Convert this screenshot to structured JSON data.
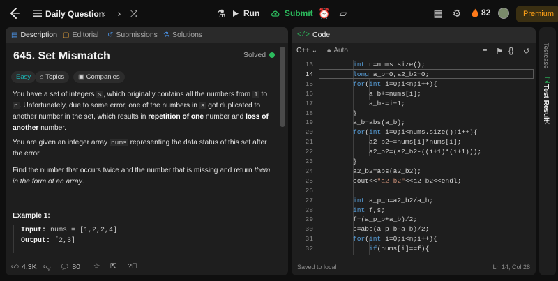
{
  "header": {
    "title": "Daily Question",
    "run_label": "Run",
    "submit_label": "Submit",
    "streak_count": "82",
    "premium_label": "Premium"
  },
  "left_tabs": [
    {
      "label": "Description",
      "icon": "description-icon"
    },
    {
      "label": "Editorial",
      "icon": "editorial-icon"
    },
    {
      "label": "Submissions",
      "icon": "submissions-icon"
    },
    {
      "label": "Solutions",
      "icon": "solutions-icon"
    }
  ],
  "problem": {
    "title": "645. Set Mismatch",
    "status": "Solved",
    "tags": {
      "difficulty": "Easy",
      "topics": "Topics",
      "companies": "Companies"
    },
    "para1": {
      "a": "You have a set of integers ",
      "c1": "s",
      "b": ", which originally contains all the numbers from ",
      "c2": "1",
      "c": " to ",
      "c3": "n",
      "d": ". Unfortunately, due to some error, one of the numbers in ",
      "c4": "s",
      "e": " got duplicated to another number in the set, which results in ",
      "bold1": "repetition of one",
      "f": " number and ",
      "bold2": "loss of another",
      "g": " number."
    },
    "para2": {
      "a": "You are given an integer array ",
      "c1": "nums",
      "b": " representing the data status of this set after the error."
    },
    "para3": {
      "a": "Find the number that occurs twice and the number that is missing and return ",
      "italic": "them in the form of an array",
      "b": "."
    },
    "example_title": "Example 1:",
    "example_input_label": "Input:",
    "example_input_value": "nums = [1,2,2,4]",
    "example_output_label": "Output:",
    "example_output_value": "[2,3]"
  },
  "left_footer": {
    "likes": "4.3K",
    "comments": "80"
  },
  "code_panel": {
    "title": "Code",
    "language": "C++",
    "mode": "Auto",
    "footer_left": "Saved to local",
    "footer_right": "Ln 14, Col 28"
  },
  "code_lines": [
    {
      "n": "13",
      "text": "int n=nums.size();"
    },
    {
      "n": "14",
      "text": "long a_b=0,a2_b2=0;"
    },
    {
      "n": "15",
      "text": "for(int i=0;i<n;i++){"
    },
    {
      "n": "16",
      "text": "a_b+=nums[i];"
    },
    {
      "n": "17",
      "text": "a_b-=i+1;"
    },
    {
      "n": "18",
      "text": "}"
    },
    {
      "n": "19",
      "text": "a_b=abs(a_b);"
    },
    {
      "n": "20",
      "text": "for(int i=0;i<nums.size();i++){"
    },
    {
      "n": "21",
      "text": "a2_b2+=nums[i]*nums[i];"
    },
    {
      "n": "22",
      "text": "a2_b2=(a2_b2-((i+1)*(i+1)));"
    },
    {
      "n": "23",
      "text": "}"
    },
    {
      "n": "24",
      "text": "a2_b2=abs(a2_b2);"
    },
    {
      "n": "25",
      "text": "cout<<\"a2_b2\"<<a2_b2<<endl;"
    },
    {
      "n": "26",
      "text": ""
    },
    {
      "n": "27",
      "text": "int a_p_b=a2_b2/a_b;"
    },
    {
      "n": "28",
      "text": "int f,s;"
    },
    {
      "n": "29",
      "text": "f=(a_p_b+a_b)/2;"
    },
    {
      "n": "30",
      "text": "s=abs(a_p_b-a_b)/2;"
    },
    {
      "n": "31",
      "text": "for(int i=0;i<n;i++){"
    },
    {
      "n": "32",
      "text": "if(nums[i]==f){"
    }
  ],
  "side_tabs": {
    "testcase": "Testcase",
    "test_result": "Test Result"
  },
  "colors": {
    "accent": "#ffa116",
    "green": "#2cbb5d",
    "easy": "#1cb8b8"
  }
}
